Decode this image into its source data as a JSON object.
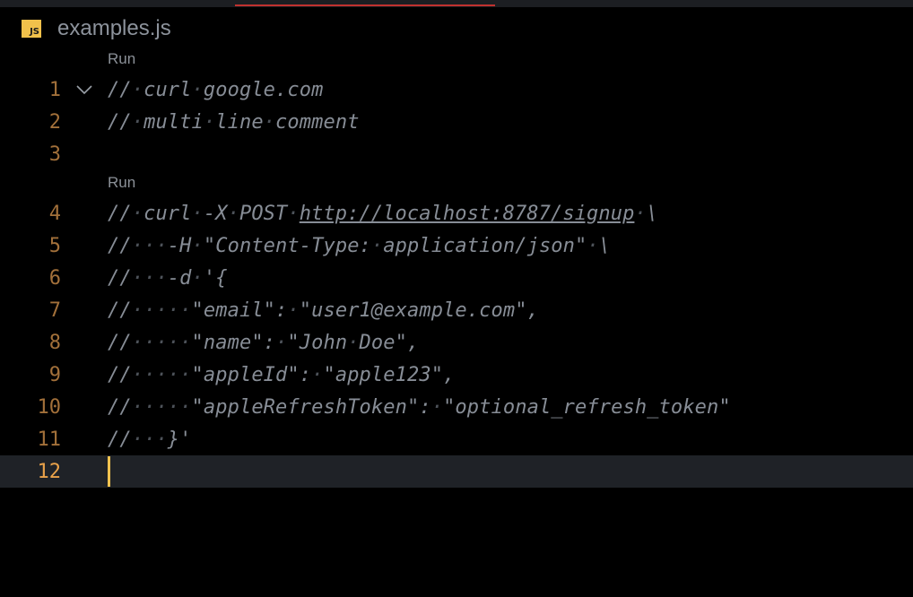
{
  "file": {
    "badge": "JS",
    "name": "examples.js"
  },
  "codelens": {
    "run_label_1": "Run",
    "run_label_2": "Run"
  },
  "lines": [
    {
      "num": "1",
      "text": "// curl google.com"
    },
    {
      "num": "2",
      "text": "// multi line comment"
    },
    {
      "num": "3",
      "text": ""
    },
    {
      "num": "4",
      "text": "// curl -X POST http://localhost:8787/signup \\"
    },
    {
      "num": "5",
      "text": "//   -H \"Content-Type: application/json\" \\"
    },
    {
      "num": "6",
      "text": "//   -d '{"
    },
    {
      "num": "7",
      "text": "//     \"email\": \"user1@example.com\","
    },
    {
      "num": "8",
      "text": "//     \"name\": \"John Doe\","
    },
    {
      "num": "9",
      "text": "//     \"appleId\": \"apple123\","
    },
    {
      "num": "10",
      "text": "//     \"appleRefreshToken\": \"optional_refresh_token\""
    },
    {
      "num": "11",
      "text": "//   }'"
    },
    {
      "num": "12",
      "text": ""
    }
  ],
  "current_line": "12",
  "url_text": "http://localhost:8787/signup",
  "colors": {
    "background": "#000000",
    "line_number": "#a2703a",
    "current_line_number": "#e9a24a",
    "comment": "#878d96",
    "cursor": "#f0c24f",
    "tab_indicator": "#c0322f"
  },
  "icons": {
    "file_type": "js-file-icon",
    "fold": "chevron-down-icon"
  }
}
